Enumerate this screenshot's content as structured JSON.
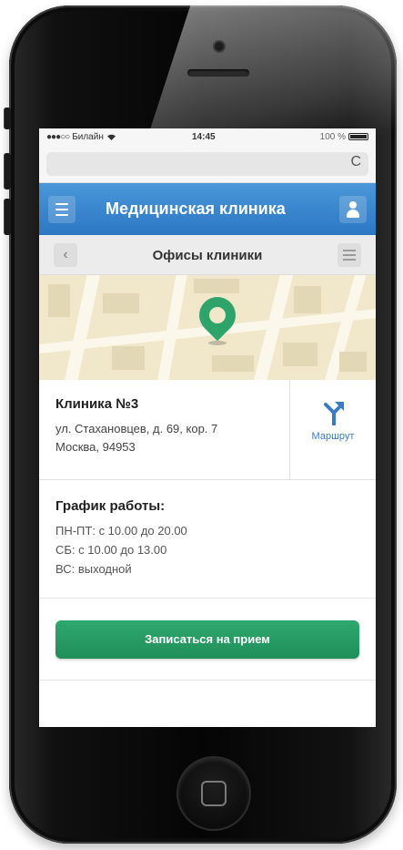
{
  "statusbar": {
    "carrier": "Билайн",
    "signal_icon": "signal-dots-icon",
    "wifi_icon": "wifi-icon",
    "time": "14:45",
    "battery": "100 %"
  },
  "browser": {
    "reload_icon": "reload-icon",
    "reload_glyph": "C"
  },
  "navbar": {
    "menu_icon": "hamburger-menu-icon",
    "title": "Медицинская клиника",
    "user_icon": "user-icon"
  },
  "subbar": {
    "back_glyph": "‹",
    "title": "Офисы клиники",
    "list_icon": "list-icon"
  },
  "map": {
    "pin_icon": "map-pin-icon",
    "pin_color": "#2ea36a"
  },
  "clinic": {
    "name": "Клиника №3",
    "address_line1": "ул. Стахановцев, д. 69, кор. 7",
    "address_line2": "Москва, 94953",
    "route_label": "Маршрут",
    "route_icon": "route-icon"
  },
  "schedule": {
    "title": "График работы:",
    "weekdays": "ПН-ПТ: с 10.00 до 20.00",
    "saturday": "СБ: с 10.00 до 13.00",
    "sunday": "ВС: выходной"
  },
  "booking": {
    "button_label": "Записаться на прием",
    "button_color": "#2ea36a"
  },
  "colors": {
    "navbar": "#3a87d0",
    "accent_green": "#2ea36a",
    "link_blue": "#3a7cc4"
  }
}
